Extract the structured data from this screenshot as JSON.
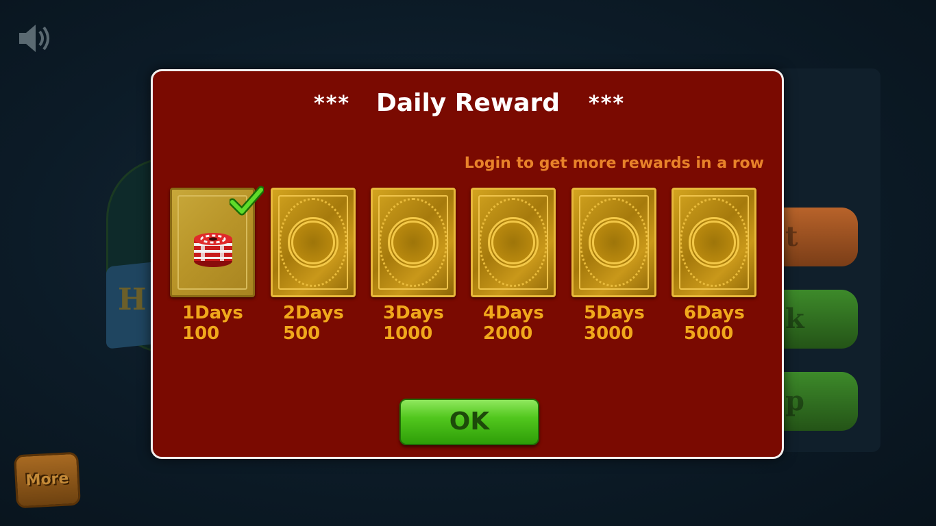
{
  "background": {
    "more_label": "More",
    "bg_letter": "H"
  },
  "dialog": {
    "title": "Daily Reward",
    "stars_left": "***",
    "stars_right": "***",
    "subtitle": "Login to get more rewards in a row",
    "ok_label": "OK",
    "rewards": [
      {
        "day": "1Days",
        "amount": "100",
        "claimed": true
      },
      {
        "day": "2Days",
        "amount": "500",
        "claimed": false
      },
      {
        "day": "3Days",
        "amount": "1000",
        "claimed": false
      },
      {
        "day": "4Days",
        "amount": "2000",
        "claimed": false
      },
      {
        "day": "5Days",
        "amount": "3000",
        "claimed": false
      },
      {
        "day": "6Days",
        "amount": "5000",
        "claimed": false
      }
    ]
  },
  "colors": {
    "dialog_bg": "#7a0a01",
    "accent_orange": "#e8822a",
    "label_gold": "#f0a81c",
    "ok_green": "#52c71e"
  },
  "icons": {
    "sound": "speaker-icon",
    "claimed": "check-icon",
    "reward": "poker-chips-icon"
  }
}
